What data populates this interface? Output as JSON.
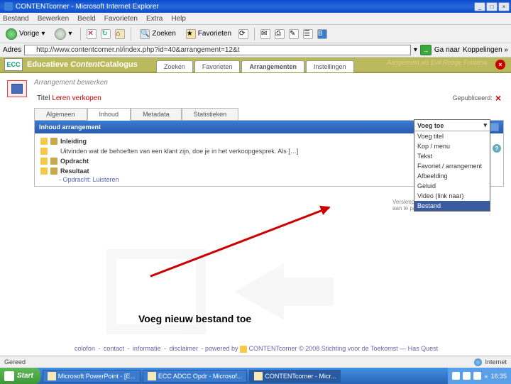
{
  "window": {
    "title": "CONTENTcorner - Microsoft Internet Explorer",
    "min": "_",
    "max": "□",
    "close": "×"
  },
  "menu": {
    "bestand": "Bestand",
    "bewerken": "Bewerken",
    "beeld": "Beeld",
    "favorieten": "Favorieten",
    "tools": "Extra",
    "help": "Help"
  },
  "toolbar": {
    "back": "Vorige",
    "search": "Zoeken",
    "favorites": "Favorieten"
  },
  "address": {
    "label": "Adres",
    "url": "http://www.contentcorner.nl/index.php?id=40&arrangement=12&t",
    "go": "Ga naar",
    "links": "Koppelingen »"
  },
  "app": {
    "logo": "ECC",
    "title_a": "Educatieve ",
    "title_b": "Content",
    "title_c": "Catalogus",
    "tabs": {
      "zoeken": "Zoeken",
      "favorieten": "Favorieten",
      "arrangementen": "Arrangementen",
      "instellingen": "Instellingen"
    },
    "user": "Aangemeld als Evil Rooge Fontana",
    "close": "×"
  },
  "page": {
    "subhead": "Arrangement bewerken",
    "help": "?",
    "title_label": "Titel ",
    "title_value": "Leren verkopen",
    "published": "Gepubliceerd: ",
    "pub_x": "×"
  },
  "subtabs": {
    "algemeen": "Algemeen",
    "inhoud": "Inhoud",
    "metadata": "Metadata",
    "statistieken": "Statistieken"
  },
  "panel": {
    "header": "Inhoud arrangement"
  },
  "tree": {
    "inleiding": "Inleiding",
    "intro_text": "Uitvinden wat de behoeften van een klant zijn, doe je in het verkoopgesprek. Als […]",
    "opdracht": "Opdracht",
    "resultaat": "Resultaat",
    "subitem": "- Opdracht: Luisteren"
  },
  "dropdown": {
    "header": "Voeg toe",
    "items": {
      "i0": "Voeg titel",
      "i1": "Kop / menu",
      "i2": "Tekst",
      "i3": "Favoriet / arrangement",
      "i4": "Afbeelding",
      "i5": "Geluid",
      "i6": "Video (link naar)",
      "i7": "Bestand"
    },
    "note": "Versleep een tegel om de volgorde aan te passen"
  },
  "caption": "Voeg nieuw bestand toe",
  "footer": {
    "colofon": "colofon",
    "contact": "contact",
    "informatie": "informatie",
    "disclaimer": "disclaimer",
    "powered": "powered by",
    "ct": "CONTENTcorner",
    "copy": "© 2008 Stichting voor de Toekomst — Has Quest"
  },
  "status": {
    "gereed": "Gereed",
    "internet": "Internet"
  },
  "taskbar": {
    "start": "Start",
    "t1": "Microsoft PowerPoint - [E...",
    "t2": "ECC ADCC Opdr - Microsof...",
    "t3": "CONTENTcorner - Micr...",
    "time": "16:35"
  }
}
